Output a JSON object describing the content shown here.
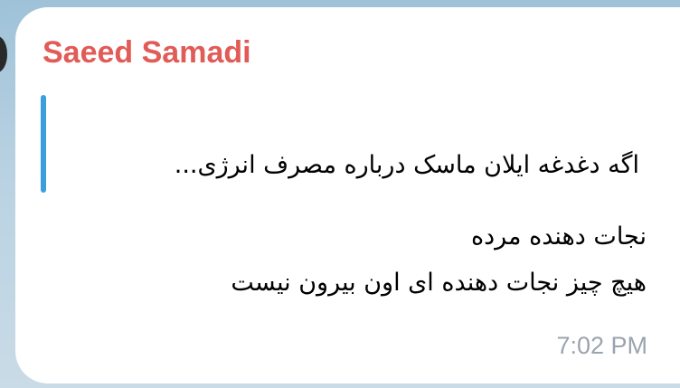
{
  "message": {
    "sender_name": "Saeed Samadi",
    "quoted_text": "اگه دغدغه ایلان ماسک درباره مصرف انرژی...",
    "lines": [
      "نجات دهنده مرده",
      "هیچ چیز نجات دهنده ای اون بیرون نیست"
    ],
    "time": "7:02 PM"
  },
  "colors": {
    "sender_name": "#e15b57",
    "quote_bar": "#3a9fdc",
    "timestamp": "#9aa4ae",
    "bubble": "#ffffff"
  }
}
